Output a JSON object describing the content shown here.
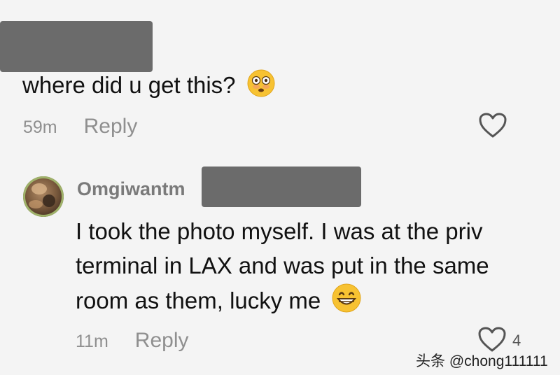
{
  "comment1": {
    "text": "where did u get this?",
    "emoji": "flushed-face",
    "time": "59m",
    "reply_label": "Reply"
  },
  "comment2": {
    "username": "Omgiwantm",
    "lines": [
      "I took the photo myself. I was at the priv",
      "terminal in LAX and was put in the same",
      "room as them, lucky me"
    ],
    "emoji": "grinning-face",
    "time": "11m",
    "reply_label": "Reply",
    "likes": "4"
  },
  "watermark": "头条 @chong111111",
  "colors": {
    "background": "#f4f4f4",
    "redaction": "#6b6b6b",
    "muted_text": "#8f8f8f",
    "emoji_yellow": "#f7c232"
  }
}
